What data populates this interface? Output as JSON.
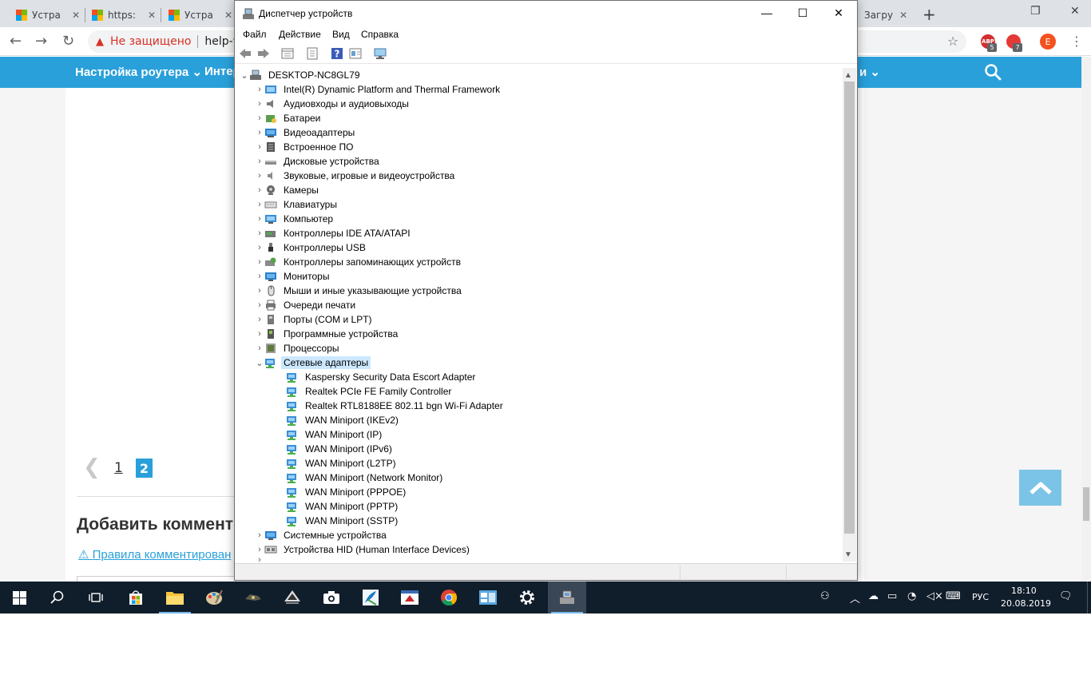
{
  "browser": {
    "tabs": [
      {
        "label": "Устра"
      },
      {
        "label": "https:"
      },
      {
        "label": "Устра"
      }
    ],
    "right_tab_label": "Загру",
    "close_glyph": "✕",
    "new_tab_glyph": "+",
    "address": {
      "security_label": "Не защищено",
      "url": "help-w"
    },
    "extensions": [
      {
        "name": "adblock",
        "label": "ABP",
        "badge": "5",
        "color": "#d32f2f"
      },
      {
        "name": "second-ext",
        "label": "",
        "badge": "7",
        "color": "#e53935"
      }
    ],
    "profile_initial": "E"
  },
  "website": {
    "nav_items": [
      {
        "label": "Настройка роутера"
      },
      {
        "label": "Интер"
      },
      {
        "label": "и"
      }
    ],
    "pager": {
      "page1": "1",
      "page2": "2"
    },
    "add_comment": "Добавить коммент",
    "rules_link": "Правила комментирован",
    "accent": "#29a0da"
  },
  "device_manager": {
    "title": "Диспетчер устройств",
    "menu": [
      "Файл",
      "Действие",
      "Вид",
      "Справка"
    ],
    "root": "DESKTOP-NC8GL79",
    "categories_before": [
      {
        "label": "Intel(R) Dynamic Platform and Thermal Framework",
        "icon": "thermal-icon"
      },
      {
        "label": "Аудиовходы и аудиовыходы",
        "icon": "speaker-icon"
      },
      {
        "label": "Батареи",
        "icon": "battery-icon"
      },
      {
        "label": "Видеоадаптеры",
        "icon": "display-adapter-icon"
      },
      {
        "label": "Встроенное ПО",
        "icon": "firmware-icon"
      },
      {
        "label": "Дисковые устройства",
        "icon": "disk-icon"
      },
      {
        "label": "Звуковые, игровые и видеоустройства",
        "icon": "sound-icon"
      },
      {
        "label": "Камеры",
        "icon": "camera-icon"
      },
      {
        "label": "Клавиатуры",
        "icon": "keyboard-icon"
      },
      {
        "label": "Компьютер",
        "icon": "computer-icon"
      },
      {
        "label": "Контроллеры IDE ATA/ATAPI",
        "icon": "ide-icon"
      },
      {
        "label": "Контроллеры USB",
        "icon": "usb-icon"
      },
      {
        "label": "Контроллеры запоминающих устройств",
        "icon": "storage-icon"
      },
      {
        "label": "Мониторы",
        "icon": "monitor-icon"
      },
      {
        "label": "Мыши и иные указывающие устройства",
        "icon": "mouse-icon"
      },
      {
        "label": "Очереди печати",
        "icon": "printer-icon"
      },
      {
        "label": "Порты (COM и LPT)",
        "icon": "port-icon"
      },
      {
        "label": "Программные устройства",
        "icon": "software-device-icon"
      },
      {
        "label": "Процессоры",
        "icon": "cpu-icon"
      }
    ],
    "expanded_category": {
      "label": "Сетевые адаптеры",
      "icon": "network-icon"
    },
    "network_adapters": [
      "Kaspersky Security Data Escort Adapter",
      "Realtek PCIe FE Family Controller",
      "Realtek RTL8188EE 802.11 bgn Wi-Fi Adapter",
      "WAN Miniport (IKEv2)",
      "WAN Miniport (IP)",
      "WAN Miniport (IPv6)",
      "WAN Miniport (L2TP)",
      "WAN Miniport (Network Monitor)",
      "WAN Miniport (PPPOE)",
      "WAN Miniport (PPTP)",
      "WAN Miniport (SSTP)"
    ],
    "categories_after": [
      {
        "label": "Системные устройства",
        "icon": "system-icon"
      },
      {
        "label": "Устройства HID (Human Interface Devices)",
        "icon": "hid-icon"
      }
    ]
  },
  "taskbar": {
    "language": "РУС",
    "time": "18:10",
    "date": "20.08.2019"
  }
}
